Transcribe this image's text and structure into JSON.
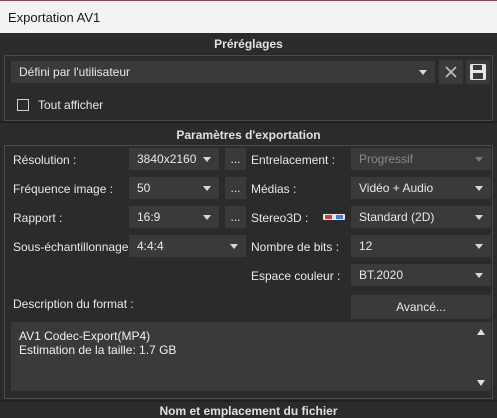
{
  "window": {
    "title": "Exportation AV1"
  },
  "presets": {
    "heading": "Préréglages",
    "selected": "Défini par l'utilisateur",
    "show_all_label": "Tout afficher",
    "show_all_checked": false
  },
  "export": {
    "heading": "Paramètres d'exportation",
    "resolution_label": "Résolution :",
    "resolution_value": "3840x2160",
    "framerate_label": "Fréquence image :",
    "framerate_value": "50",
    "ratio_label": "Rapport :",
    "ratio_value": "16:9",
    "subsampling_label": "Sous-échantillonnage :",
    "subsampling_value": "4:4:4",
    "more_label": "...",
    "interlace_label": "Entrelacement :",
    "interlace_value": "Progressif",
    "media_label": "Médias :",
    "media_value": "Vidéo + Audio",
    "stereo_label": "Stereo3D :",
    "stereo_value": "Standard (2D)",
    "bits_label": "Nombre de bits :",
    "bits_value": "12",
    "colorspace_label": "Espace couleur :",
    "colorspace_value": "BT.2020",
    "format_desc_label": "Description du format :",
    "advanced_label": "Avancé...",
    "format_desc_line1": "AV1 Codec-Export(MP4)",
    "format_desc_line2": "Estimation de la taille: 1.7 GB"
  },
  "footer": {
    "heading": "Nom et emplacement du fichier"
  },
  "colors": {
    "panel": "#2b2b2b",
    "control": "#3a3a3a",
    "titlebar": "#f3f3f3"
  },
  "icons": {
    "clear": "close-icon",
    "save": "save-icon",
    "stereo": "3d-glasses-icon"
  }
}
